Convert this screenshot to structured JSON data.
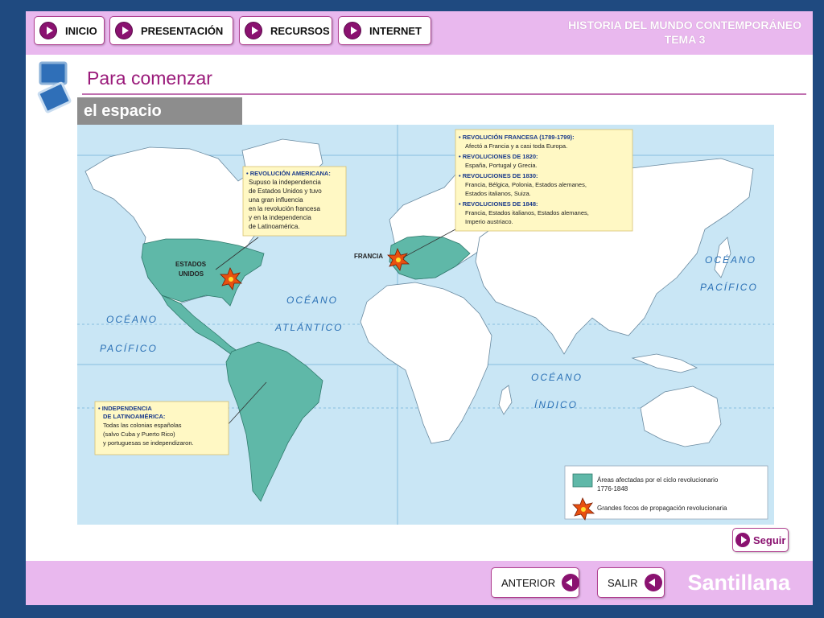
{
  "nav": {
    "inicio": "INICIO",
    "presentacion": "PRESENTACIÓN",
    "recursos": "RECURSOS",
    "internet": "INTERNET"
  },
  "course": {
    "line1": "HISTORIA DEL MUNDO CONTEMPORÁNEO",
    "line2": "TEMA 3"
  },
  "page": {
    "title": "Para comenzar",
    "section": "el espacio"
  },
  "map": {
    "oceans": {
      "atlantico_1": "OCÉANO",
      "atlantico_2": "ATLÁNTICO",
      "pacifico_w1": "OCÉANO",
      "pacifico_w2": "PACÍFICO",
      "pacifico_e1": "OCÉANO",
      "pacifico_e2": "PACÍFICO",
      "indico_1": "OCÉANO",
      "indico_2": "ÍNDICO"
    },
    "places": {
      "usa_1": "ESTADOS",
      "usa_2": "UNIDOS",
      "francia": "FRANCIA"
    },
    "box_americana": {
      "title": "• REVOLUCIÓN AMERICANA:",
      "lines": [
        "Supuso la independencia",
        "de Estados Unidos y tuvo",
        "una gran influencia",
        "en la revolución francesa",
        "y en la independencia",
        "de Latinoamérica."
      ]
    },
    "box_europa": {
      "t1": "• REVOLUCIÓN FRANCESA (1789-1799):",
      "l1": "Afectó a Francia y a casi toda Europa.",
      "t2": "• REVOLUCIONES DE 1820:",
      "l2": "España, Portugal y Grecia.",
      "t3": "• REVOLUCIONES DE 1830:",
      "l3a": "Francia, Bélgica, Polonia, Estados alemanes,",
      "l3b": "Estados italianos, Suiza.",
      "t4": "• REVOLUCIONES DE 1848:",
      "l4a": "Francia, Estados italianos, Estados alemanes,",
      "l4b": "Imperio austriaco."
    },
    "box_latam": {
      "t1": "• INDEPENDENCIA",
      "t2": "DE LATINOAMÉRICA:",
      "lines": [
        "Todas las colonias españolas",
        "(salvo Cuba y Puerto Rico)",
        "y portuguesas se independizaron."
      ]
    },
    "legend": {
      "item1a": "Áreas afectadas por el ciclo revolucionario",
      "item1b": "1776-1848",
      "item2": "Grandes focos de propagación revolucionaria"
    },
    "colors": {
      "ocean": "#c9e6f5",
      "land": "#ffffff",
      "affected": "#5fb8a8",
      "box": "#fff8c4"
    }
  },
  "buttons": {
    "seguir": "Seguir",
    "anterior": "ANTERIOR",
    "salir": "SALIR"
  },
  "brand": "Santillana",
  "colors": {
    "background": "#1f4a80",
    "bar": "#e9b8ee",
    "accent": "#8a1270"
  }
}
